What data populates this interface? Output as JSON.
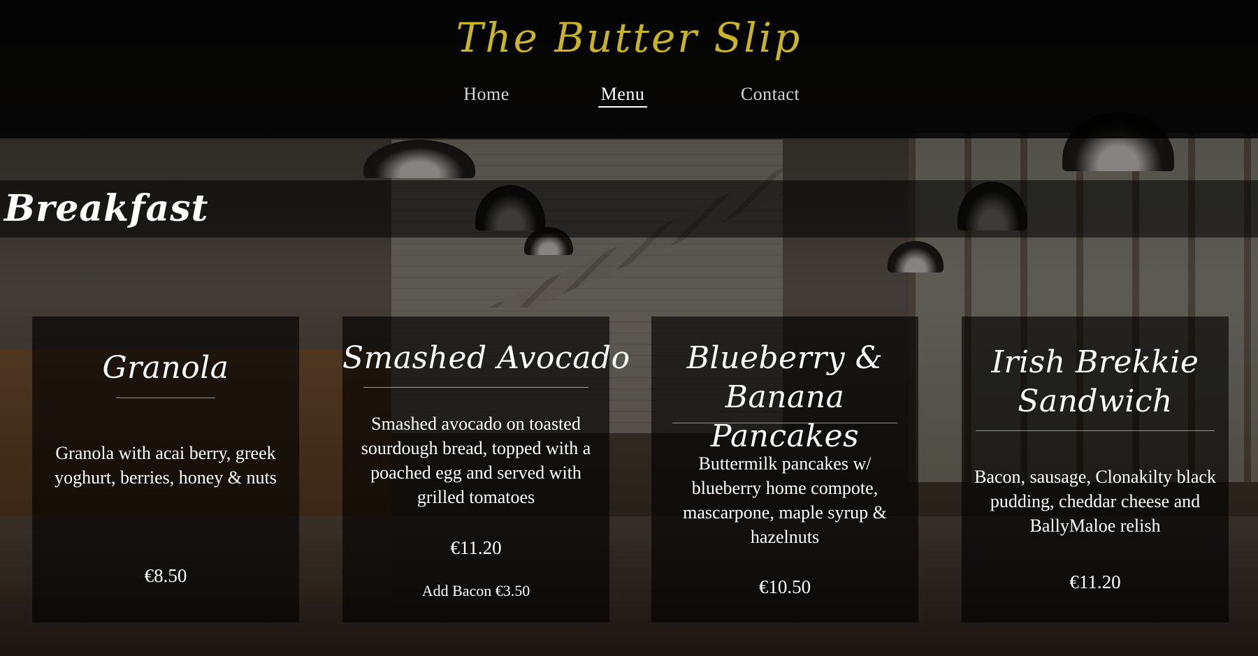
{
  "site": {
    "brand": "The Butter Slip",
    "nav": [
      {
        "label": "Home"
      },
      {
        "label": "Menu"
      },
      {
        "label": "Contact"
      }
    ],
    "active_nav": "Menu"
  },
  "section": {
    "title": "Breakfast"
  },
  "items": [
    {
      "name": "Granola",
      "description": "Granola with acai berry, greek yoghurt, berries, honey & nuts",
      "price": "€8.50"
    },
    {
      "name": "Smashed Avocado",
      "description": "Smashed avocado on toasted sourdough bread, topped with a poached egg and served with grilled tomatoes",
      "price": "€11.20",
      "extra": "Add Bacon €3.50"
    },
    {
      "name": "Blueberry & Banana Pancakes",
      "description": "Buttermilk pancakes w/ blueberry home compote, mascarpone, maple syrup & hazelnuts",
      "price": "€10.50"
    },
    {
      "name": "Irish Brekkie Sandwich",
      "description": "Bacon, sausage, Clonakilty black pudding, cheddar cheese and BallyMaloe relish",
      "price": "€11.20"
    }
  ],
  "colors": {
    "brand": "#c8b32a",
    "text": "#ffffff",
    "nav_inactive": "#d6d6d6"
  }
}
